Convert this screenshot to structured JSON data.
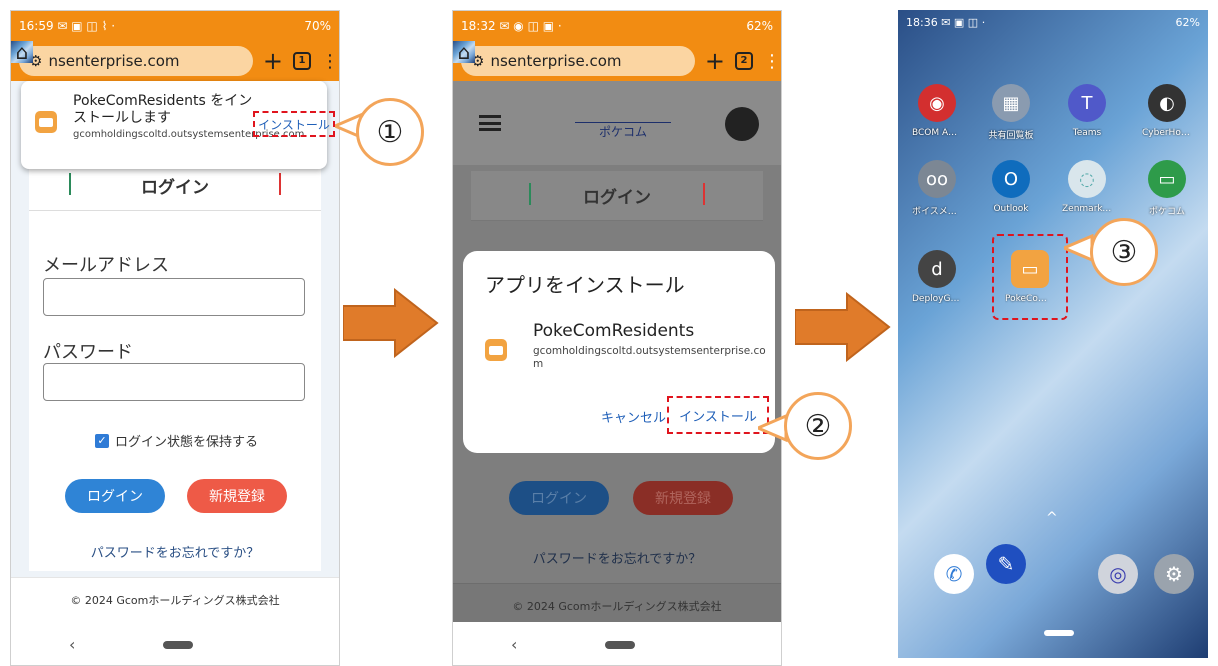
{
  "phone1": {
    "status_time": "16:59",
    "status_battery": "70%",
    "url": "nsenterprise.com",
    "tab_count": "1",
    "popup": {
      "title": "PokeComResidents をインストールします",
      "domain": "gcomholdingscoltd.outsystemsenterprise.com",
      "install": "インストール"
    },
    "login_heading": "ログイン",
    "email_label": "メールアドレス",
    "password_label": "パスワード",
    "remember_label": "ログイン状態を保持する",
    "login_button": "ログイン",
    "register_button": "新規登録",
    "forgot_link": "パスワードをお忘れですか？",
    "footer": "© 2024 Gcomホールディングス株式会社"
  },
  "phone2": {
    "status_time": "18:32",
    "status_battery": "62%",
    "url": "nsenterprise.com",
    "tab_count": "2",
    "logo_text": "ポケコム",
    "login_heading": "ログイン",
    "dialog": {
      "title": "アプリをインストール",
      "app_name": "PokeComResidents",
      "domain": "gcomholdingscoltd.outsystemsenterprise.com",
      "cancel": "キャンセル",
      "install": "インストール"
    },
    "login_button": "ログイン",
    "register_button": "新規登録",
    "forgot_link": "パスワードをお忘れですか？",
    "footer": "© 2024 Gcomホールディングス株式会社"
  },
  "phone3": {
    "status_time": "18:36",
    "status_battery": "62%",
    "apps": [
      {
        "label": "BCOM AntiV",
        "icon": "shield-icon",
        "color": "#d32f2f"
      },
      {
        "label": "共有回覧板",
        "icon": "board-icon",
        "color": "#8a9bb0"
      },
      {
        "label": "Teams",
        "icon": "teams-icon",
        "color": "#5059c9"
      },
      {
        "label": "CyberHouse D.",
        "icon": "cyber-icon",
        "color": "#333333"
      },
      {
        "label": "ボイスメッセ",
        "icon": "voicemail-icon",
        "color": "#7c8794"
      },
      {
        "label": "Outlook",
        "icon": "outlook-icon",
        "color": "#0f6cbd"
      },
      {
        "label": "ZenmarketHelp",
        "icon": "zen-icon",
        "color": "#d9e6ec"
      },
      {
        "label": "ポケコム",
        "icon": "pokecom-icon",
        "color": "#2e9b4a"
      },
      {
        "label": "DeployGate",
        "icon": "deploygate-icon",
        "color": "#444444"
      },
      {
        "label": "PokeComRe.",
        "icon": "pokecom-residents-icon",
        "color": "#f2a341"
      }
    ]
  },
  "callouts": [
    "①",
    "②",
    "③"
  ]
}
